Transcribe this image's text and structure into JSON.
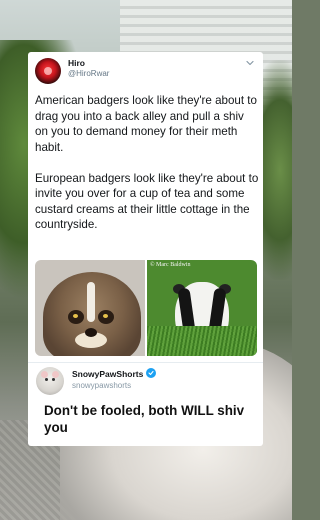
{
  "tweet": {
    "author_name": "Hiro",
    "author_handle": "@HiroRwar",
    "paragraphs": [
      "American badgers look like they're about to drag you into a back alley and pull a shiv on you to demand money for their meth habit.",
      "European badgers look like they're about to invite you over for a cup of tea and some custard creams at their little cottage in the countryside."
    ],
    "photo_credit": "© Marc Baldwin"
  },
  "reply": {
    "author_name": "SnowyPawShorts",
    "author_handle": "snowypawshorts",
    "text": "Don't be fooled, both WILL shiv you"
  },
  "icons": {
    "more": "chevron-down-icon",
    "verified": "verified-check-icon"
  },
  "colors": {
    "verified": "#1da1f2",
    "handle": "#657786"
  }
}
